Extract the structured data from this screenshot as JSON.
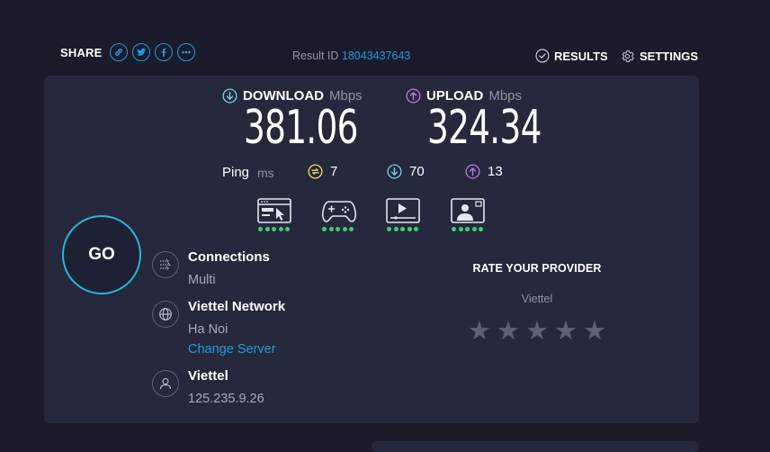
{
  "header": {
    "share_label": "SHARE",
    "share_buttons": [
      "link-icon",
      "twitter-icon",
      "facebook-icon",
      "more-icon"
    ],
    "result_id_label": "Result ID",
    "result_id": "18043437643",
    "results_label": "RESULTS",
    "settings_label": "SETTINGS"
  },
  "download": {
    "label": "DOWNLOAD",
    "unit": "Mbps",
    "value": "381.06"
  },
  "upload": {
    "label": "UPLOAD",
    "unit": "Mbps",
    "value": "324.34"
  },
  "ping": {
    "label": "Ping",
    "unit": "ms",
    "idle": "7",
    "download": "70",
    "upload": "13"
  },
  "experience_icons": [
    {
      "name": "web-browsing-icon",
      "rating": 5
    },
    {
      "name": "gaming-icon",
      "rating": 5
    },
    {
      "name": "video-streaming-icon",
      "rating": 5
    },
    {
      "name": "video-chat-icon",
      "rating": 5
    }
  ],
  "go_label": "GO",
  "connections": {
    "title": "Connections",
    "value": "Multi"
  },
  "server": {
    "title": "Viettel Network",
    "location": "Ha Noi",
    "change_label": "Change Server"
  },
  "provider": {
    "title": "Viettel",
    "ip": "125.235.9.26"
  },
  "rating": {
    "title": "RATE YOUR PROVIDER",
    "isp": "Viettel",
    "stars": 5
  },
  "colors": {
    "background": "#1b1b2c",
    "panel": "#26283b",
    "accent_blue": "#1f9bde",
    "download_cyan": "#6ed3e4",
    "upload_purple": "#b47ce0",
    "idle_yellow": "#eadf65",
    "rating_green": "#3ccf73",
    "go_ring": "#29b6d8"
  }
}
